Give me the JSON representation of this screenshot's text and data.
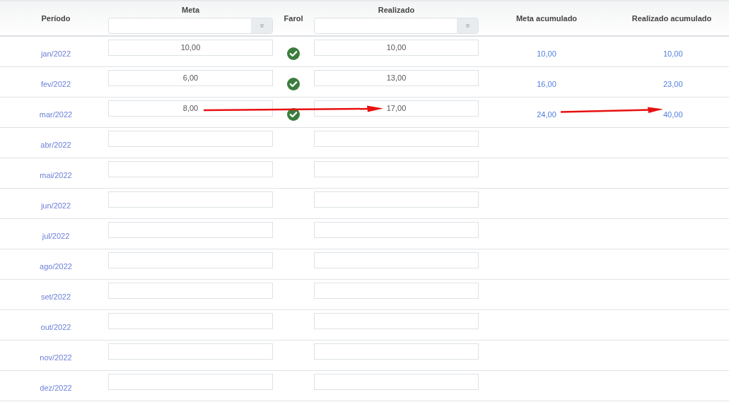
{
  "header": {
    "periodo": "Período",
    "meta": "Meta",
    "farol": "Farol",
    "realizado": "Realizado",
    "meta_acumulado": "Meta acumulado",
    "realizado_acumulado": "Realizado acumulado"
  },
  "rows": [
    {
      "period": "jan/2022",
      "meta": "10,00",
      "farol_ok": true,
      "realizado": "10,00",
      "meta_acumulado": "10,00",
      "realizado_acumulado": "10,00"
    },
    {
      "period": "fev/2022",
      "meta": "6,00",
      "farol_ok": true,
      "realizado": "13,00",
      "meta_acumulado": "16,00",
      "realizado_acumulado": "23,00"
    },
    {
      "period": "mar/2022",
      "meta": "8,00",
      "farol_ok": true,
      "realizado": "17,00",
      "meta_acumulado": "24,00",
      "realizado_acumulado": "40,00",
      "arrow_meta_to_realizado": true,
      "arrow_acumulado": true
    },
    {
      "period": "abr/2022"
    },
    {
      "period": "mai/2022"
    },
    {
      "period": "jun/2022"
    },
    {
      "period": "jul/2022"
    },
    {
      "period": "ago/2022"
    },
    {
      "period": "set/2022"
    },
    {
      "period": "out/2022"
    },
    {
      "period": "nov/2022"
    },
    {
      "period": "dez/2022"
    }
  ]
}
